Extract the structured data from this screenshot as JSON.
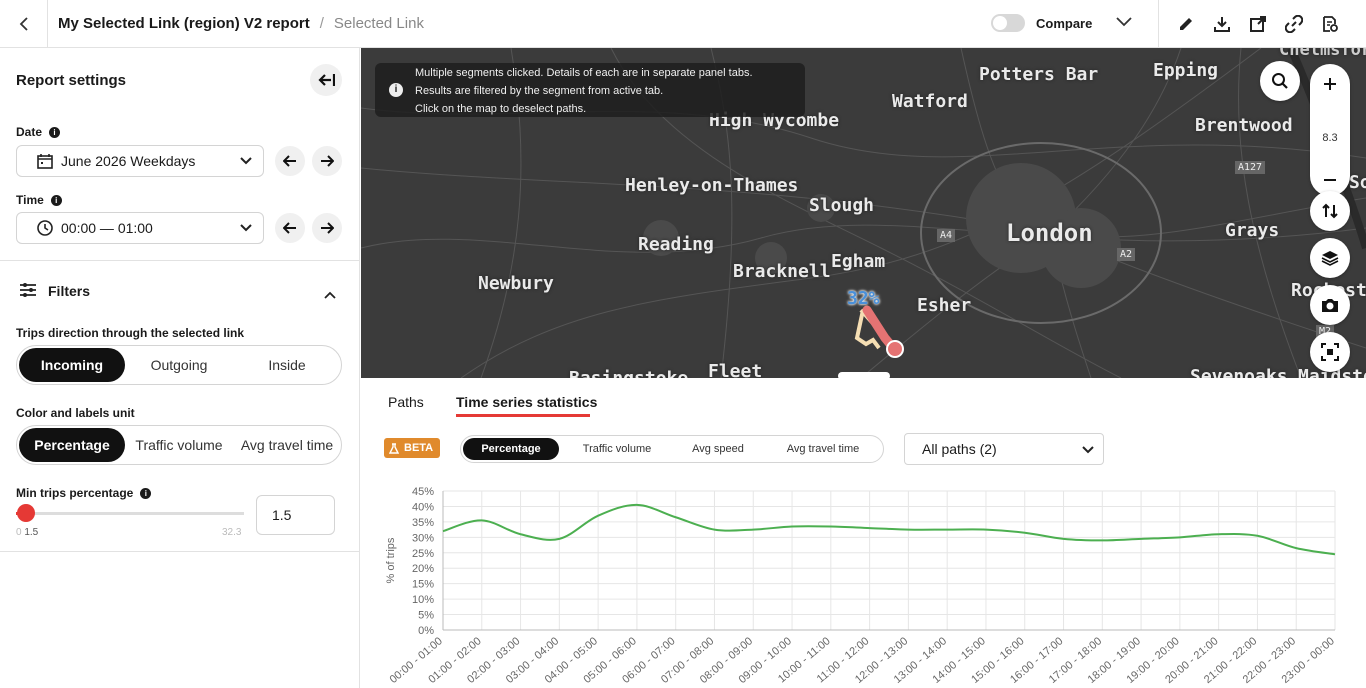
{
  "header": {
    "title": "My Selected Link (region) V2 report",
    "separator": "/",
    "breadcrumb": "Selected Link",
    "compare_label": "Compare",
    "compare_on": false,
    "icons": [
      "back-icon",
      "chevron-down-icon",
      "pencil-icon",
      "download-icon",
      "export-icon",
      "link-icon",
      "report-settings-icon"
    ]
  },
  "sidebar": {
    "title": "Report settings",
    "date_label": "Date",
    "date_value": "June 2026 Weekdays",
    "time_label": "Time",
    "time_value": "00:00 — 01:00",
    "filters_title": "Filters",
    "direction_label": "Trips direction through the selected link",
    "direction_options": [
      "Incoming",
      "Outgoing",
      "Inside"
    ],
    "direction_active": "Incoming",
    "unit_label": "Color and labels unit",
    "unit_options": [
      "Percentage",
      "Traffic volume",
      "Avg travel time"
    ],
    "unit_active": "Percentage",
    "min_trips_label": "Min trips percentage",
    "min_trips_value": "1.5",
    "slider_min": "0",
    "slider_current": "1.5",
    "slider_max": "32.3",
    "slider_fraction": 0.046
  },
  "map": {
    "notice": {
      "line1": "Multiple segments clicked. Details of each are in separate panel tabs.",
      "line2": "Results are filtered by the segment from active tab.",
      "line3": "Click on the map to deselect paths."
    },
    "zoom_level": "8.3",
    "segment_label": "32%",
    "places": {
      "potters_bar": "Potters Bar",
      "epping": "Epping",
      "watford": "Watford",
      "high_wycombe": "High Wycombe",
      "brentwood": "Brentwood",
      "henley": "Henley-on-Thames",
      "slough": "Slough",
      "london": "London",
      "grays": "Grays",
      "reading": "Reading",
      "bracknell": "Bracknell",
      "egham": "Egham",
      "newbury": "Newbury",
      "esher": "Esher",
      "fleet": "Fleet",
      "sevenoaks": "Sevenoaks",
      "basingstoke": "Basingstoke",
      "maidstone": "Maidsto",
      "rochester": "Rochester",
      "so": "So"
    },
    "roads": {
      "a127": "A127",
      "a4": "A4",
      "a2": "A2",
      "m2": "M2"
    },
    "colors": {
      "background": "#3b3b3b",
      "path": "#e57373",
      "label": "#4a90d9"
    }
  },
  "panel": {
    "tabs": [
      "Paths",
      "Time series statistics"
    ],
    "active_tab": "Time series statistics",
    "beta_label": "BETA",
    "unit_options": [
      "Percentage",
      "Traffic volume",
      "Avg speed",
      "Avg travel time"
    ],
    "unit_active": "Percentage",
    "paths_select": "All paths (2)"
  },
  "chart_data": {
    "type": "line",
    "ylabel": "% of trips",
    "xlabel": "",
    "ylim": [
      0,
      45
    ],
    "yticks": [
      "0%",
      "5%",
      "10%",
      "15%",
      "20%",
      "25%",
      "30%",
      "35%",
      "40%",
      "45%"
    ],
    "categories": [
      "00:00 - 01:00",
      "01:00 - 02:00",
      "02:00 - 03:00",
      "03:00 - 04:00",
      "04:00 - 05:00",
      "05:00 - 06:00",
      "06:00 - 07:00",
      "07:00 - 08:00",
      "08:00 - 09:00",
      "09:00 - 10:00",
      "10:00 - 11:00",
      "11:00 - 12:00",
      "12:00 - 13:00",
      "13:00 - 14:00",
      "14:00 - 15:00",
      "15:00 - 16:00",
      "16:00 - 17:00",
      "17:00 - 18:00",
      "18:00 - 19:00",
      "19:00 - 20:00",
      "20:00 - 21:00",
      "21:00 - 22:00",
      "22:00 - 23:00",
      "23:00 - 00:00"
    ],
    "series": [
      {
        "values": [
          32,
          35.5,
          31,
          29.5,
          37,
          40.5,
          36.5,
          32.5,
          32.5,
          33.5,
          33.5,
          33,
          32.5,
          32.5,
          32.5,
          31.5,
          29.5,
          29,
          29.5,
          30,
          31,
          30.5,
          26.5,
          24.5
        ],
        "color": "#4caf50"
      }
    ],
    "grid": true,
    "legend": "none"
  }
}
